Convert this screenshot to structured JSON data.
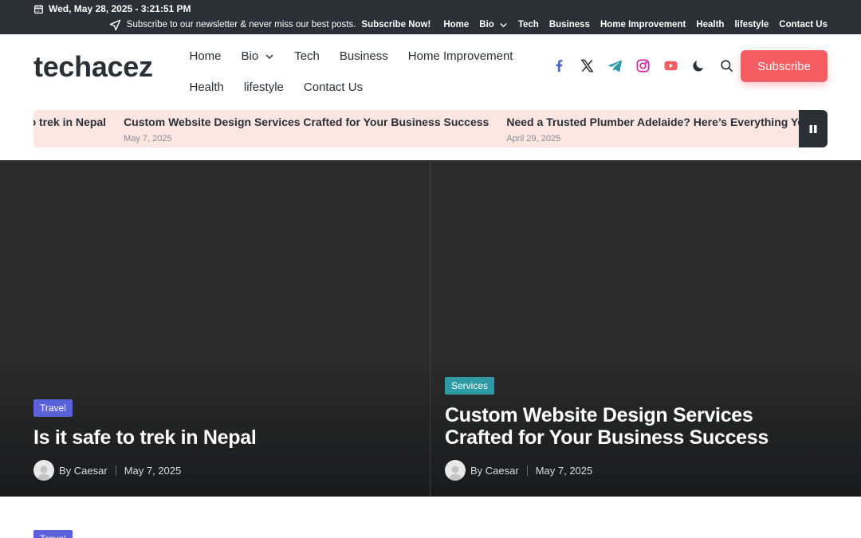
{
  "topbar": {
    "datetime": "Wed, May 28, 2025 - 3:21:51 PM",
    "promo_text": "Subscribe to our newsletter & never miss our best posts.",
    "promo_cta": "Subscribe Now!",
    "nav": [
      "Home",
      "Bio",
      "Tech",
      "Business",
      "Home Improvement",
      "Health",
      "lifestyle",
      "Contact Us"
    ]
  },
  "header": {
    "logo": "techacez",
    "nav": [
      "Home",
      "Bio",
      "Tech",
      "Business",
      "Home Improvement",
      "Health",
      "lifestyle",
      "Contact Us"
    ],
    "social_icons": [
      "facebook-icon",
      "x-twitter-icon",
      "telegram-icon",
      "instagram-icon",
      "youtube-icon"
    ],
    "subscribe_label": "Subscribe"
  },
  "ticker": {
    "items": [
      {
        "title": "Is it safe to trek in Nepal",
        "date": ""
      },
      {
        "title": "Custom Website Design Services Crafted for Your Business Success",
        "date": "May 7, 2025"
      },
      {
        "title": "Need a Trusted Plumber Adelaide? Here’s Everything You Must Know",
        "date": "April 29, 2025"
      }
    ]
  },
  "hero": [
    {
      "category": "Travel",
      "title": "Is it safe to trek in Nepal",
      "author": "By Caesar",
      "date": "May 7, 2025"
    },
    {
      "category": "Services",
      "title": "Custom Website Design Services Crafted for Your Business Success",
      "author": "By Caesar",
      "date": "May 7, 2025"
    }
  ],
  "next_section": {
    "category": "Travel"
  },
  "colors": {
    "topbar_bg": "#2b2f36",
    "accent": "#f65d63",
    "ticker_bg": "#fbe6e1",
    "travel_badge": "#5b61d9",
    "services_badge": "#2f9aa6"
  }
}
